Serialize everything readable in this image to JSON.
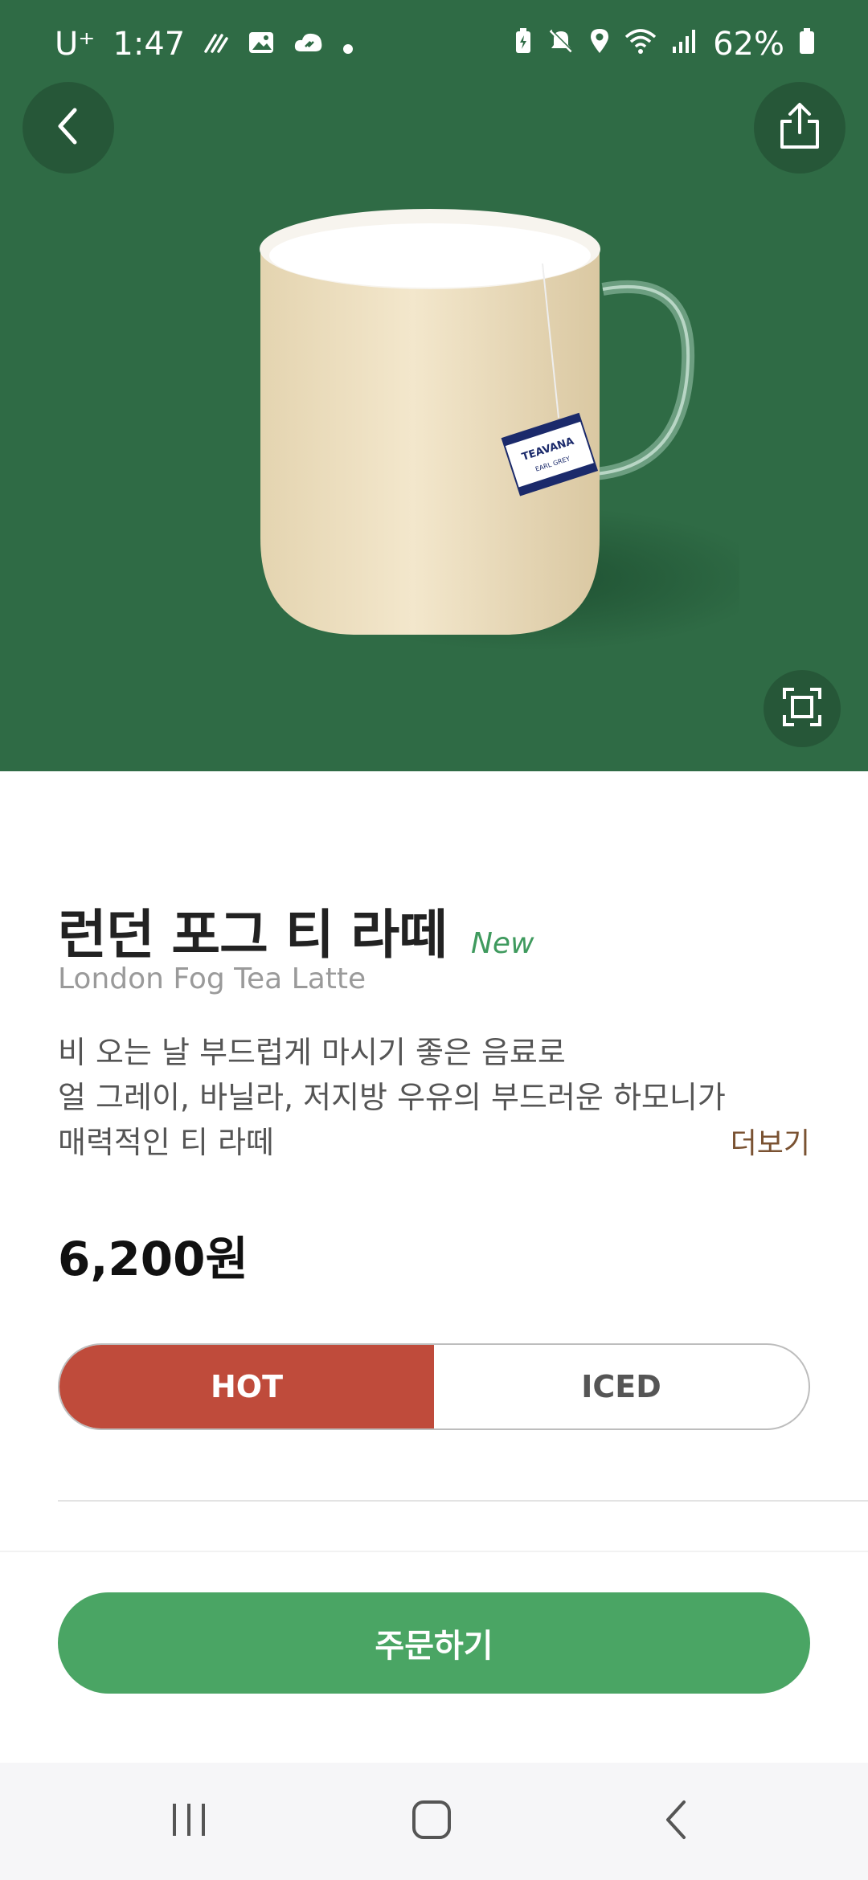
{
  "status_bar": {
    "carrier": "U⁺",
    "time": "1:47",
    "battery": "62%"
  },
  "product": {
    "name_ko": "런던 포그 티 라떼",
    "badge": "New",
    "name_en": "London Fog Tea Latte",
    "description_lines": [
      "비 오는 날 부드럽게 마시기 좋은 음료로",
      "얼 그레이, 바닐라, 저지방 우유의 부드러운 하모니가",
      "매력적인 티 라떼"
    ],
    "more_label": "더보기",
    "price": "6,200원",
    "tea_tag": {
      "brand": "TEAVANA",
      "flavor": "EARL GREY"
    }
  },
  "temperature_options": {
    "hot": "HOT",
    "iced": "ICED",
    "selected": "HOT"
  },
  "order_button_label": "주문하기",
  "colors": {
    "hero_bg": "#2f6b45",
    "hot_active": "#bf4b3b",
    "order_button": "#4aa564",
    "new_badge": "#3f9a5e",
    "more_link": "#7a5232"
  },
  "icons": {
    "back": "chevron-left-icon",
    "share": "share-icon",
    "expand": "expand-icon",
    "nav_recents": "recents-icon",
    "nav_home": "home-icon",
    "nav_back": "back-icon"
  }
}
